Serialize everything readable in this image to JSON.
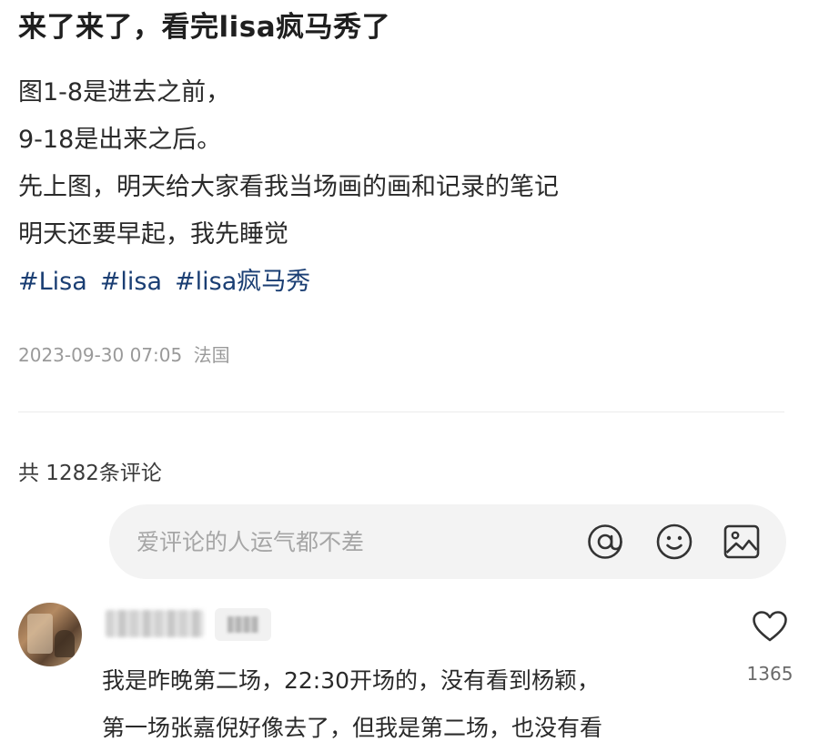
{
  "post": {
    "title": "来了来了，看完lisa疯马秀了",
    "body_lines": [
      "图1-8是进去之前，",
      "9-18是出来之后。",
      "先上图，明天给大家看我当场画的画和记录的笔记",
      "明天还要早起，我先睡觉"
    ],
    "tags": [
      "#Lisa",
      "#lisa",
      "#lisa疯马秀"
    ],
    "timestamp": "2023-09-30 07:05",
    "location": "法国"
  },
  "comments_section": {
    "count_label": "共 1282条评论",
    "input_placeholder": "爱评论的人运气都不差",
    "icons": [
      "at-icon",
      "emoji-icon",
      "image-icon"
    ]
  },
  "comment": {
    "text_lines": [
      "我是昨晚第二场，22:30开场的，没有看到杨颖，",
      "第一场张嘉倪好像去了，但我是第二场，也没有看"
    ],
    "like_count": "1365"
  },
  "colors": {
    "tag": "#1a3e73",
    "meta": "#9a9a9a",
    "input_bg": "#f3f3f3",
    "icon": "#333333"
  }
}
